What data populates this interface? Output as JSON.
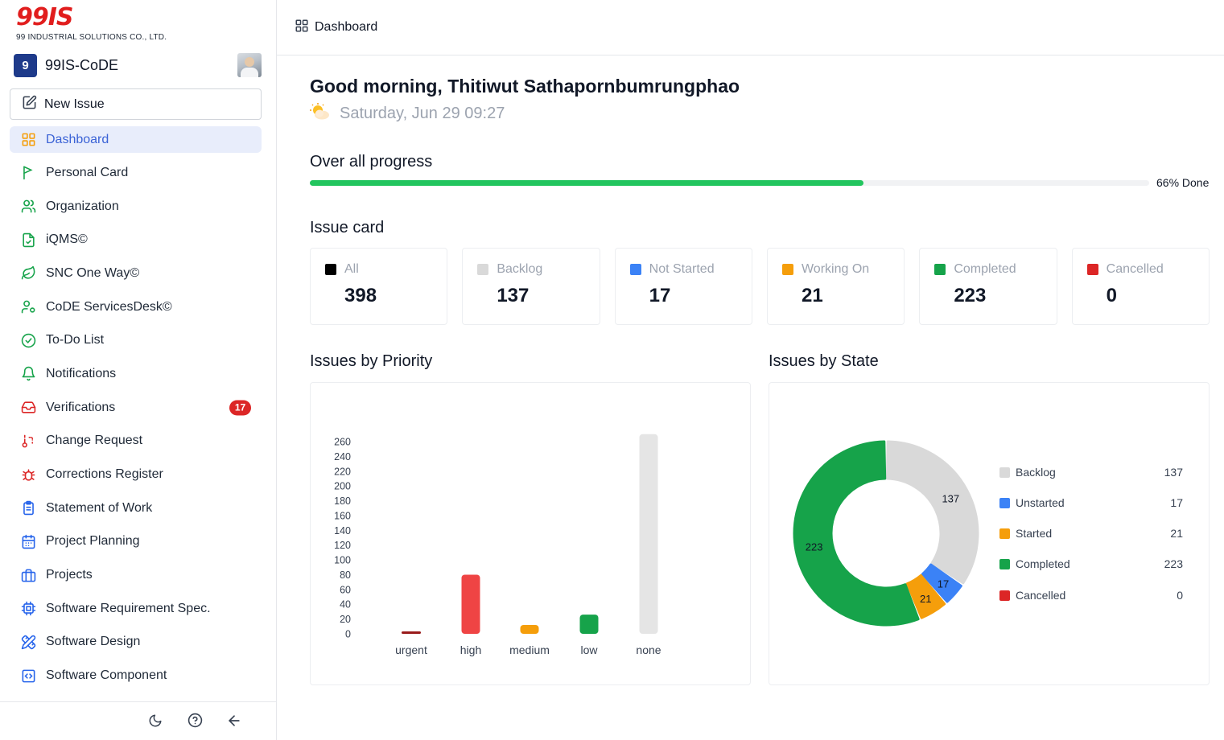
{
  "brand": {
    "logo": "99IS",
    "company": "99 INDUSTRIAL SOLUTIONS CO., LTD."
  },
  "workspace": {
    "badge": "9",
    "name": "99IS-CoDE"
  },
  "new_issue_label": "New Issue",
  "nav": [
    {
      "label": "Dashboard",
      "icon": "grid-icon",
      "active": true
    },
    {
      "label": "Personal Card",
      "icon": "flag-icon"
    },
    {
      "label": "Organization",
      "icon": "users-icon"
    },
    {
      "label": "iQMS©",
      "icon": "file-check-icon"
    },
    {
      "label": "SNC One Way©",
      "icon": "leaf-icon"
    },
    {
      "label": "CoDE ServicesDesk©",
      "icon": "user-cog-icon"
    },
    {
      "label": "To-Do List",
      "icon": "check-circle-icon"
    },
    {
      "label": "Notifications",
      "icon": "bell-icon"
    },
    {
      "label": "Verifications",
      "icon": "inbox-icon",
      "badge": "17"
    },
    {
      "label": "Change Request",
      "icon": "git-compare-icon"
    },
    {
      "label": "Corrections Register",
      "icon": "bug-icon"
    },
    {
      "label": "Statement of Work",
      "icon": "clipboard-list-icon"
    },
    {
      "label": "Project Planning",
      "icon": "calendar-icon"
    },
    {
      "label": "Projects",
      "icon": "briefcase-icon"
    },
    {
      "label": "Software Requirement Spec.",
      "icon": "cpu-icon"
    },
    {
      "label": "Software Design",
      "icon": "pencil-ruler-icon"
    },
    {
      "label": "Software Component",
      "icon": "code-square-icon"
    }
  ],
  "footer_icons": [
    "moon-icon",
    "help-circle-icon",
    "arrow-left-icon"
  ],
  "topbar": {
    "title": "Dashboard"
  },
  "greeting": "Good morning, Thitiwut Sathapornbumrungphao",
  "date": "Saturday, Jun 29 09:27",
  "progress": {
    "title": "Over all progress",
    "percent": 66,
    "label": "66% Done"
  },
  "issue_card": {
    "title": "Issue card",
    "cards": [
      {
        "label": "All",
        "value": "398",
        "color": "#000000"
      },
      {
        "label": "Backlog",
        "value": "137",
        "color": "#d9d9d9"
      },
      {
        "label": "Not Started",
        "value": "17",
        "color": "#3b82f6"
      },
      {
        "label": "Working On",
        "value": "21",
        "color": "#f59e0b"
      },
      {
        "label": "Completed",
        "value": "223",
        "color": "#16a34a"
      },
      {
        "label": "Cancelled",
        "value": "0",
        "color": "#dc2626"
      }
    ]
  },
  "priority_title": "Issues by Priority",
  "state_title": "Issues by State",
  "chart_data": [
    {
      "type": "bar",
      "title": "Issues by Priority",
      "categories": [
        "urgent",
        "high",
        "medium",
        "low",
        "none"
      ],
      "values": [
        2,
        80,
        12,
        26,
        270
      ],
      "colors": [
        "#991b1b",
        "#ef4444",
        "#f59e0b",
        "#16a34a",
        "#e5e5e5"
      ],
      "yticks": [
        0,
        20,
        40,
        60,
        80,
        100,
        120,
        140,
        160,
        180,
        200,
        220,
        240,
        260
      ],
      "ylim": [
        0,
        270
      ],
      "grid": false
    },
    {
      "type": "pie",
      "donut": true,
      "title": "Issues by State",
      "labels": [
        "Backlog",
        "Unstarted",
        "Started",
        "Completed",
        "Cancelled"
      ],
      "values": [
        137,
        17,
        21,
        223,
        0
      ],
      "colors": [
        "#d9d9d9",
        "#3b82f6",
        "#f59e0b",
        "#16a34a",
        "#dc2626"
      ],
      "legend": "right"
    }
  ]
}
